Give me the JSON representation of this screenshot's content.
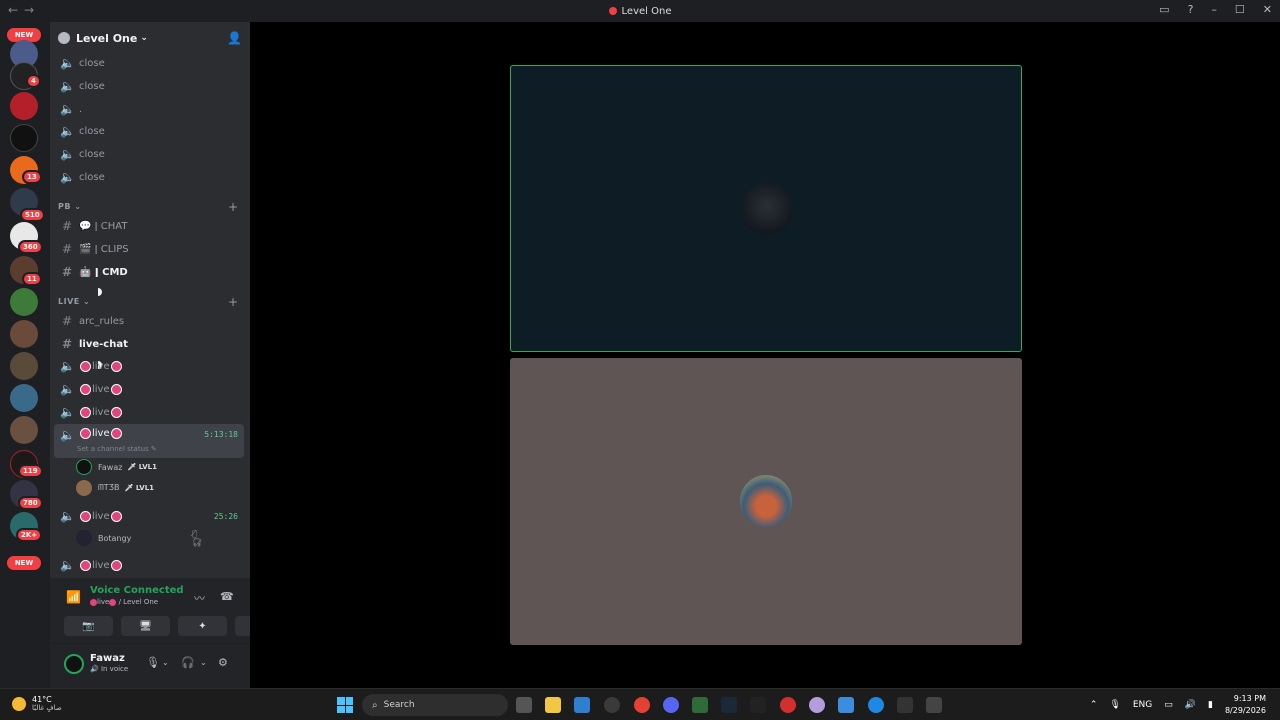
{
  "window": {
    "title": "Level One"
  },
  "server": {
    "name": "Level One"
  },
  "guilds": {
    "new_top": "NEW",
    "new_bottom": "NEW",
    "badges": [
      "4",
      "13",
      "510",
      "360",
      "11",
      "119",
      "780",
      "2K+"
    ]
  },
  "channels_top": [
    "close",
    "close",
    ".",
    "close",
    "close",
    "close"
  ],
  "categories": {
    "pb": "PB",
    "live": "LIVE"
  },
  "pb_channels": [
    "CHAT",
    "CLIPS",
    "CMD"
  ],
  "live_text_channels": [
    "arc_rules",
    "live-chat"
  ],
  "voice_channel_name": "live",
  "active_voice": {
    "timer": "5:13:18",
    "status_hint": "Set a channel status",
    "users": [
      {
        "name": "Fawaz",
        "tag": "LVL1"
      },
      {
        "name": "ᗰTƷB",
        "tag": "LVL1"
      }
    ]
  },
  "second_voice": {
    "timer": "25:26",
    "users": [
      {
        "name": "Botangy"
      }
    ]
  },
  "voice_panel": {
    "title": "Voice Connected",
    "channel": "live",
    "server": "/ Level One"
  },
  "user": {
    "name": "Fawaz",
    "status": "In voice"
  },
  "taskbar": {
    "temp": "41°C",
    "weather": "صافٍ غالبًا",
    "search": "Search",
    "lang": "ENG",
    "time": "9:13 PM",
    "date": "8/29/2026"
  },
  "colors": {
    "accent_green": "#23a559",
    "badge_red": "#f23f43",
    "live_pink": "#e0457b"
  }
}
